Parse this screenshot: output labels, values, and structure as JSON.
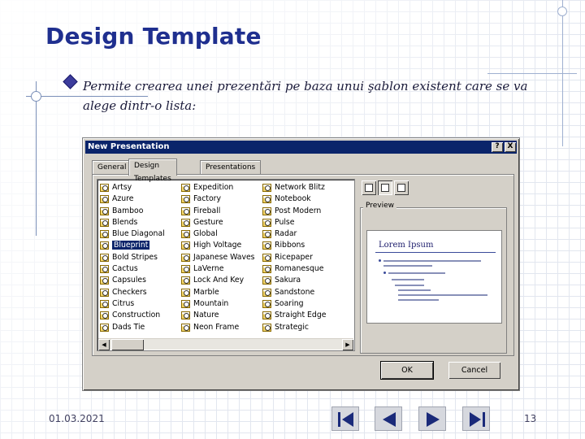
{
  "slide": {
    "title": "Design Template",
    "bullet_text": "Permite crearea unei prezentări pe baza unui şablon existent care se va alege dintr-o  lista:",
    "date": "01.03.2021",
    "page_number": "13",
    "nav_icons": [
      "first-slide-icon",
      "previous-slide-icon",
      "next-slide-icon",
      "last-slide-icon"
    ]
  },
  "dialog": {
    "title": "New Presentation",
    "titlebar_buttons": {
      "help": "?",
      "close": "X"
    },
    "tabs": [
      {
        "label": "General"
      },
      {
        "label": "Design Templates",
        "active": true
      },
      {
        "label": "Presentations"
      }
    ],
    "template_columns": [
      [
        "Artsy",
        "Azure",
        "Bamboo",
        "Blends",
        "Blue Diagonal",
        "Blueprint",
        "Bold Stripes",
        "Cactus",
        "Capsules",
        "Checkers",
        "Citrus",
        "Construction",
        "Dads Tie"
      ],
      [
        "Expedition",
        "Factory",
        "Fireball",
        "Gesture",
        "Global",
        "High Voltage",
        "Japanese Waves",
        "LaVerne",
        "Lock And Key",
        "Marble",
        "Mountain",
        "Nature",
        "Neon Frame"
      ],
      [
        "Network Blitz",
        "Notebook",
        "Post Modern",
        "Pulse",
        "Radar",
        "Ribbons",
        "Ricepaper",
        "Romanesque",
        "Sakura",
        "Sandstone",
        "Soaring",
        "Straight Edge",
        "Strategic"
      ]
    ],
    "selected_template": "Blueprint",
    "preview": {
      "label": "Preview",
      "slide_title": "Lorem Ipsum"
    },
    "buttons": {
      "ok": "OK",
      "cancel": "Cancel"
    },
    "view_icons": [
      "large-icons-view-icon",
      "list-view-icon",
      "details-view-icon"
    ]
  },
  "colors": {
    "title": "#1f2f8f",
    "dialog_titlebar": "#0a246a",
    "dialog_face": "#d4d0c8",
    "selection": "#0a246a"
  }
}
